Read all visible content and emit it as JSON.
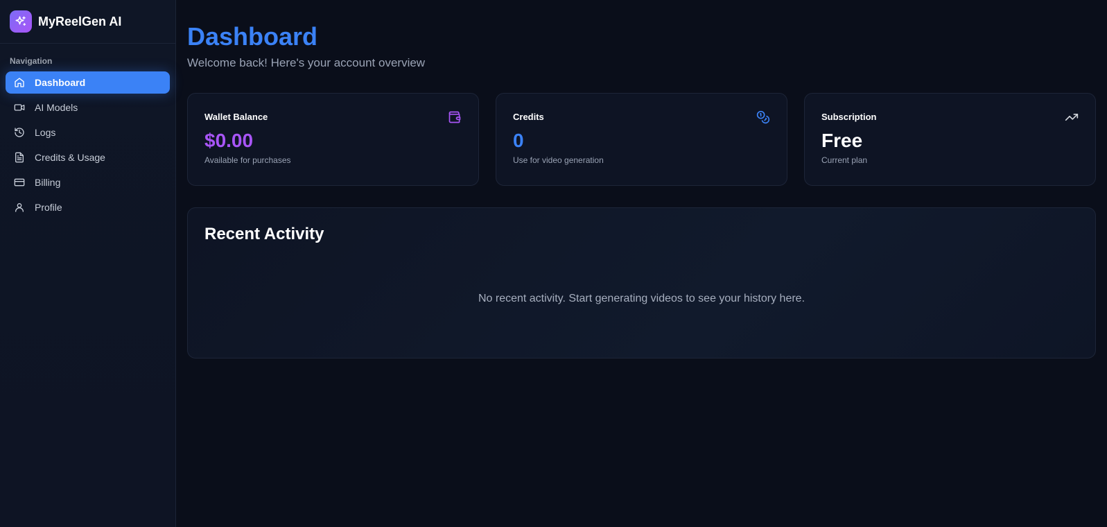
{
  "brand": {
    "name": "MyReelGen AI",
    "icon": "sparkles-icon"
  },
  "sidebar": {
    "heading": "Navigation",
    "items": [
      {
        "label": "Dashboard",
        "icon": "home-icon",
        "active": true
      },
      {
        "label": "AI Models",
        "icon": "video-camera-icon",
        "active": false
      },
      {
        "label": "Logs",
        "icon": "history-icon",
        "active": false
      },
      {
        "label": "Credits & Usage",
        "icon": "document-icon",
        "active": false
      },
      {
        "label": "Billing",
        "icon": "credit-card-icon",
        "active": false
      },
      {
        "label": "Profile",
        "icon": "user-icon",
        "active": false
      }
    ]
  },
  "header": {
    "title": "Dashboard",
    "subtitle": "Welcome back! Here's your account overview"
  },
  "cards": [
    {
      "title": "Wallet Balance",
      "value": "$0.00",
      "caption": "Available for purchases",
      "icon": "wallet-icon",
      "color": "#a855f7"
    },
    {
      "title": "Credits",
      "value": "0",
      "caption": "Use for video generation",
      "icon": "coins-icon",
      "color": "#3b82f6"
    },
    {
      "title": "Subscription",
      "value": "Free",
      "caption": "Current plan",
      "icon": "trending-up-icon",
      "color": "#ffffff"
    }
  ],
  "activity": {
    "title": "Recent Activity",
    "empty_message": "No recent activity. Start generating videos to see your history here."
  },
  "colors": {
    "accent": "#3b82f6",
    "purple": "#a855f7",
    "background": "#0a0e1a"
  }
}
